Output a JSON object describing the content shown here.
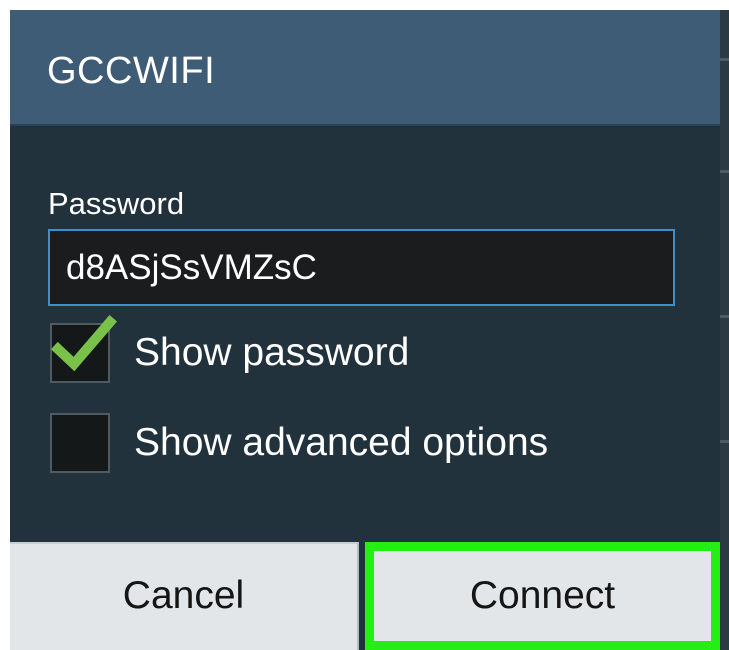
{
  "dialog": {
    "title": "GCCWIFI"
  },
  "password": {
    "label": "Password",
    "value": "d8ASjSsVMZsC"
  },
  "options": {
    "show_password": {
      "label": "Show password",
      "checked": true
    },
    "show_advanced": {
      "label": "Show advanced options",
      "checked": false
    }
  },
  "buttons": {
    "cancel": "Cancel",
    "connect": "Connect"
  },
  "colors": {
    "title_bar": "#3f5c76",
    "dialog_bg": "#22323d",
    "input_focus_border": "#3d8fd0",
    "check_mark": "#7ac14a",
    "highlight": "#25ee15",
    "button_bg": "#e2e6e8"
  },
  "icons": {
    "checkbox_checked": "check-mark-icon"
  }
}
